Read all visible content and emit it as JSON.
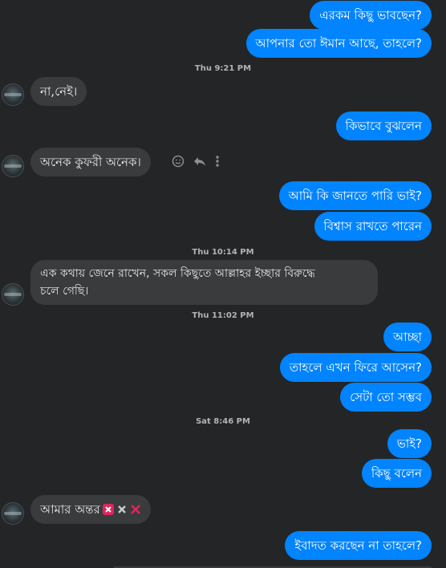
{
  "conversation": {
    "messages": [
      {
        "id": "m1",
        "side": "out",
        "text": "এরকম কিছু ভাবছেন?"
      },
      {
        "id": "m2",
        "side": "out",
        "text": "আপনার তো ঈমান আছে, তাহলে?"
      },
      {
        "id": "m3",
        "side": "in",
        "text": "না,নেই।"
      },
      {
        "id": "m4",
        "side": "out",
        "text": "কিভাবে বুঝলেন"
      },
      {
        "id": "m5",
        "side": "in",
        "text": "অনেক কুফরী অনেক।"
      },
      {
        "id": "m6",
        "side": "out",
        "text": "আমি কি জানতে পারি ভাই?"
      },
      {
        "id": "m7",
        "side": "out",
        "text": "বিশ্বাস রাখতে পারেন"
      },
      {
        "id": "m8",
        "side": "in",
        "text_line1": "এক কথায় জেনে রাখেন, সকল কিছুতে আল্লাহর ইচ্ছার বিরুদ্ধে",
        "text_line2": "চলে গেছি।"
      },
      {
        "id": "m9",
        "side": "out",
        "text": "আচ্ছা"
      },
      {
        "id": "m10",
        "side": "out",
        "text": "তাহলে এখন ফিরে আসেন?"
      },
      {
        "id": "m11",
        "side": "out",
        "text": "সেটা তো সম্ভব"
      },
      {
        "id": "m12",
        "side": "out",
        "text": "ভাই?"
      },
      {
        "id": "m13",
        "side": "out",
        "text": "কিছু বলেন"
      },
      {
        "id": "m14",
        "side": "in",
        "text": "আমার অন্তর",
        "emojis": [
          "cross-mark-button",
          "multiply-sign",
          "cross-mark"
        ]
      },
      {
        "id": "m15",
        "side": "out",
        "text": "ইবাদত করছেন না তাহলে?"
      }
    ],
    "timestamps": {
      "t1": "Thu 9:21 PM",
      "t2": "Thu 10:14 PM",
      "t3": "Thu 11:02 PM",
      "t4": "Sat 8:46 PM"
    },
    "actions": [
      "smiley-icon",
      "reply-icon",
      "more-icon"
    ],
    "colors": {
      "outgoing": "#0084ff",
      "incoming": "#3a3b3c",
      "background": "#242526"
    }
  }
}
